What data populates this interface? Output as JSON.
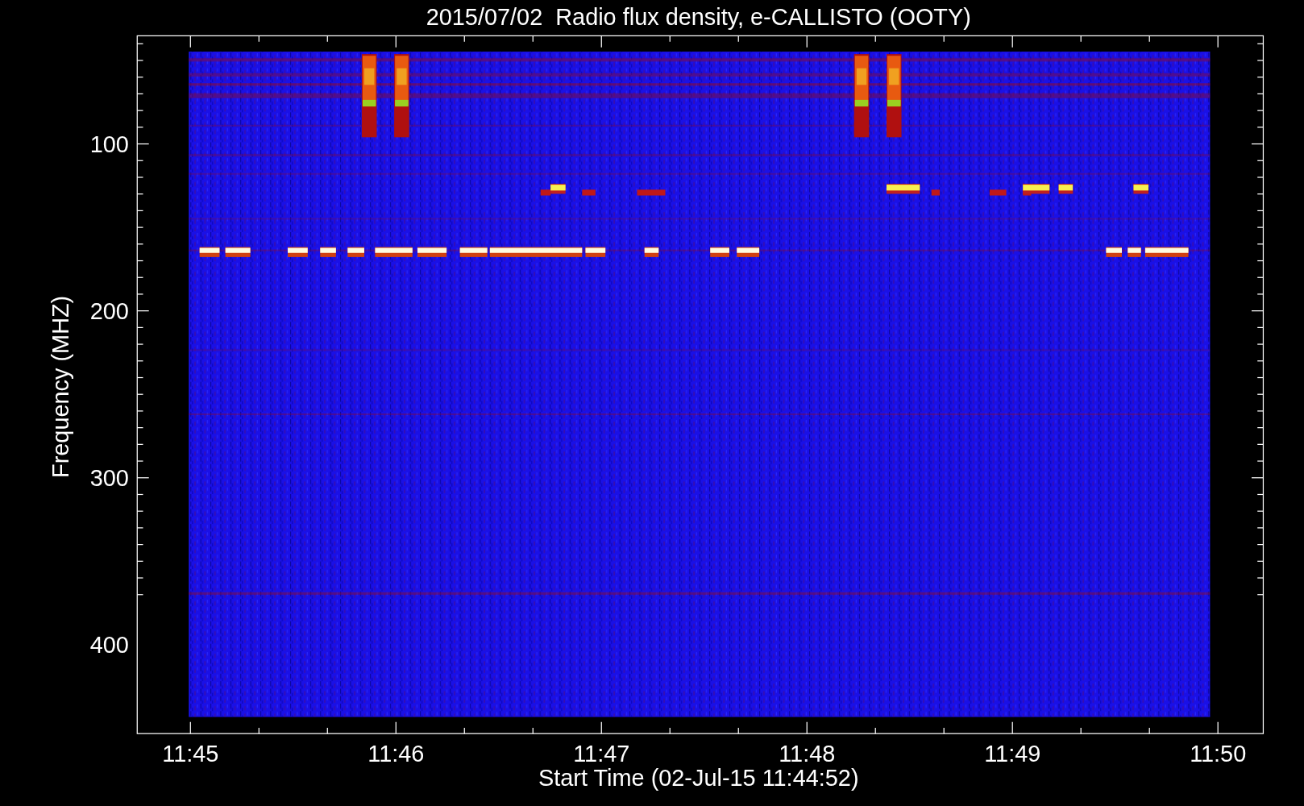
{
  "title": "2015/07/02  Radio flux density, e-CALLISTO (OOTY)",
  "y_axis": {
    "label": "Frequency (MHZ)",
    "ticks": [
      "100",
      "200",
      "300",
      "400"
    ]
  },
  "x_axis": {
    "label": "Start Time (02-Jul-15 11:44:52)",
    "ticks": [
      "11:45",
      "11:46",
      "11:47",
      "11:48",
      "11:49",
      "11:50"
    ]
  }
}
